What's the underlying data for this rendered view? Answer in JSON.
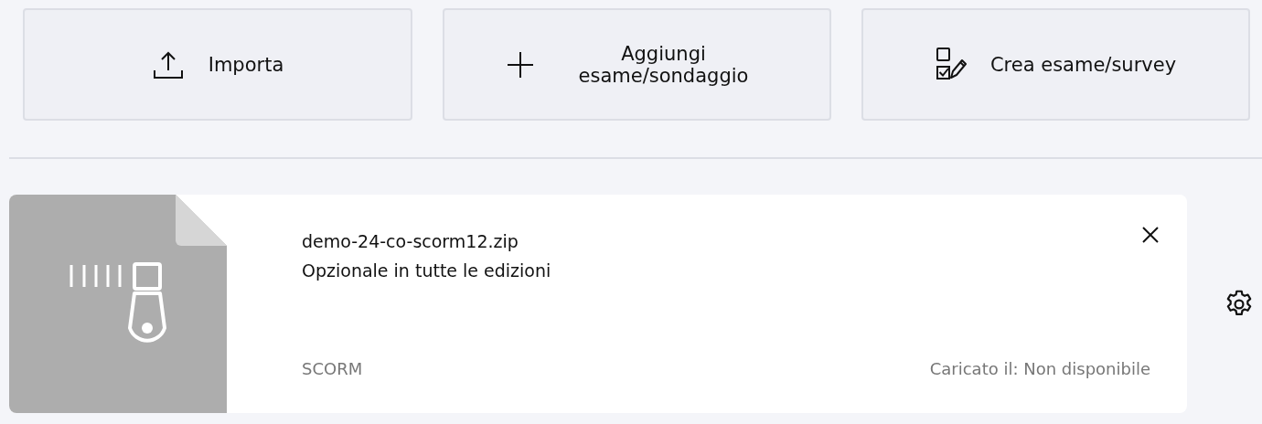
{
  "actions": [
    {
      "kind": "upload",
      "label": "Importa"
    },
    {
      "kind": "add",
      "label": "Aggiungi esame/sondaggio"
    },
    {
      "kind": "create",
      "label": "Crea esame/survey"
    }
  ],
  "file_card": {
    "kind": "zip",
    "filename": "demo-24-co-scorm12.zip",
    "availability": "Opzionale in tutte le edizioni",
    "type": "SCORM",
    "uploaded": "Caricato il: Non disponibile"
  }
}
